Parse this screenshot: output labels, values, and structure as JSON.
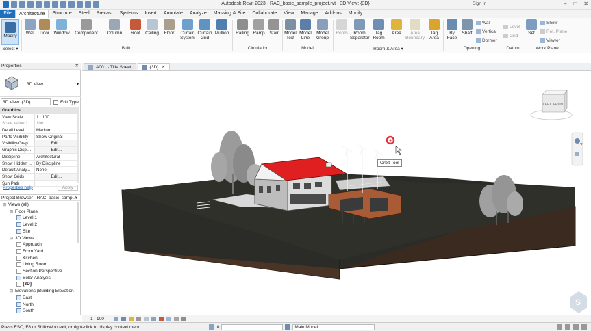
{
  "window": {
    "title": "Autodesk Revit 2023 - RAC_basic_sample_project.rvt - 3D View: {3D}",
    "sign_in": "Sign In",
    "controls": [
      "–",
      "□",
      "✕"
    ]
  },
  "ribbon_tabs": [
    "File",
    "Architecture",
    "Structure",
    "Steel",
    "Precast",
    "Systems",
    "Insert",
    "Annotate",
    "Analyze",
    "Massing & Site",
    "Collaborate",
    "View",
    "Manage",
    "Add-Ins",
    "Modify"
  ],
  "ribbon": {
    "modify": "Modify",
    "select": "Select ▾",
    "build": {
      "label": "Build",
      "buttons": [
        "Wall",
        "Door",
        "Window",
        "Component",
        "Column",
        "Roof",
        "Ceiling",
        "Floor",
        "Curtain System",
        "Curtain Grid",
        "Mullion"
      ]
    },
    "circulation": {
      "label": "Circulation",
      "buttons": [
        "Railing",
        "Ramp",
        "Stair"
      ]
    },
    "model": {
      "label": "Model",
      "buttons": [
        "Model Text",
        "Model Line",
        "Model Group"
      ]
    },
    "room_area": {
      "label": "Room & Area ▾",
      "buttons": [
        "Room",
        "Room Separator",
        "Tag Room",
        "Area",
        "Area Boundary",
        "Tag Area"
      ]
    },
    "opening": {
      "label": "Opening",
      "buttons": [
        "By Face",
        "Shaft"
      ],
      "small": [
        "Wall",
        "Vertical",
        "Dormer"
      ]
    },
    "datum": {
      "label": "Datum",
      "small": [
        "Level",
        "Grid"
      ]
    },
    "work_plane": {
      "label": "Work Plane",
      "buttons": [
        "Set"
      ],
      "small": [
        "Show",
        "Ref. Plane",
        "Viewer"
      ]
    }
  },
  "properties": {
    "panel_title": "Properties",
    "type_name": "3D View",
    "view_selector": "3D View: {3D}",
    "edit_type": "Edit Type",
    "rows": [
      {
        "k": "Graphics",
        "v": "",
        "hdr": true
      },
      {
        "k": "View Scale",
        "v": "1 : 100"
      },
      {
        "k": "Scale Value 1:",
        "v": "100",
        "dim": true
      },
      {
        "k": "Detail Level",
        "v": "Medium"
      },
      {
        "k": "Parts Visibility",
        "v": "Show Original"
      },
      {
        "k": "Visibility/Grap...",
        "v": "Edit...",
        "btn": true
      },
      {
        "k": "Graphic Displ...",
        "v": "Edit...",
        "btn": true
      },
      {
        "k": "Discipline",
        "v": "Architectural"
      },
      {
        "k": "Show Hidden ...",
        "v": "By Discipline"
      },
      {
        "k": "Default Analy...",
        "v": "None"
      },
      {
        "k": "Show Grids",
        "v": "Edit...",
        "btn": true
      },
      {
        "k": "Sun Path",
        "v": ""
      }
    ],
    "help": "Properties help",
    "apply": "Apply"
  },
  "project_browser": {
    "title": "Project Browser - RAC_basic_sampl...",
    "nodes": [
      {
        "label": "Views (all)",
        "toggle": "⊟",
        "indent": 0,
        "kind": "root"
      },
      {
        "label": "Floor Plans",
        "toggle": "⊟",
        "indent": 1,
        "kind": "folder"
      },
      {
        "label": "Level 1",
        "indent": 2,
        "kind": "view"
      },
      {
        "label": "Level 2",
        "indent": 2,
        "kind": "view"
      },
      {
        "label": "Site",
        "indent": 2,
        "kind": "view"
      },
      {
        "label": "3D Views",
        "toggle": "⊟",
        "indent": 1,
        "kind": "folder"
      },
      {
        "label": "Approach",
        "indent": 2,
        "kind": "plain"
      },
      {
        "label": "From Yard",
        "indent": 2,
        "kind": "plain"
      },
      {
        "label": "Kitchen",
        "indent": 2,
        "kind": "plain"
      },
      {
        "label": "Living Room",
        "indent": 2,
        "kind": "plain"
      },
      {
        "label": "Section Perspective",
        "indent": 2,
        "kind": "plain"
      },
      {
        "label": "Solar Analysis",
        "indent": 2,
        "kind": "view"
      },
      {
        "label": "{3D}",
        "indent": 2,
        "kind": "plain",
        "bold": true
      },
      {
        "label": "Elevations (Building Elevation",
        "toggle": "⊟",
        "indent": 1,
        "kind": "folder"
      },
      {
        "label": "East",
        "indent": 2,
        "kind": "view"
      },
      {
        "label": "North",
        "indent": 2,
        "kind": "view"
      },
      {
        "label": "South",
        "indent": 2,
        "kind": "view"
      }
    ]
  },
  "doc_tabs": [
    {
      "label": "A001 - Title Sheet",
      "active": false
    },
    {
      "label": "{3D}",
      "active": true
    }
  ],
  "viewcube": {
    "left": "LEFT",
    "front": "FRONT"
  },
  "tooltip": "Orbit Tool",
  "view_controls": {
    "scale": "1 : 100"
  },
  "status": {
    "message": "Press ESC, F8 or Shift+W to exit, or right-click to display context menu.",
    "model": "Main Model",
    "zero": ":0"
  },
  "colors": {
    "accent": "#1f6fbf",
    "roof": "#e02020",
    "ground": "#3b2a1f",
    "grass": "#2a2a26",
    "cursor": "#e8303a"
  }
}
